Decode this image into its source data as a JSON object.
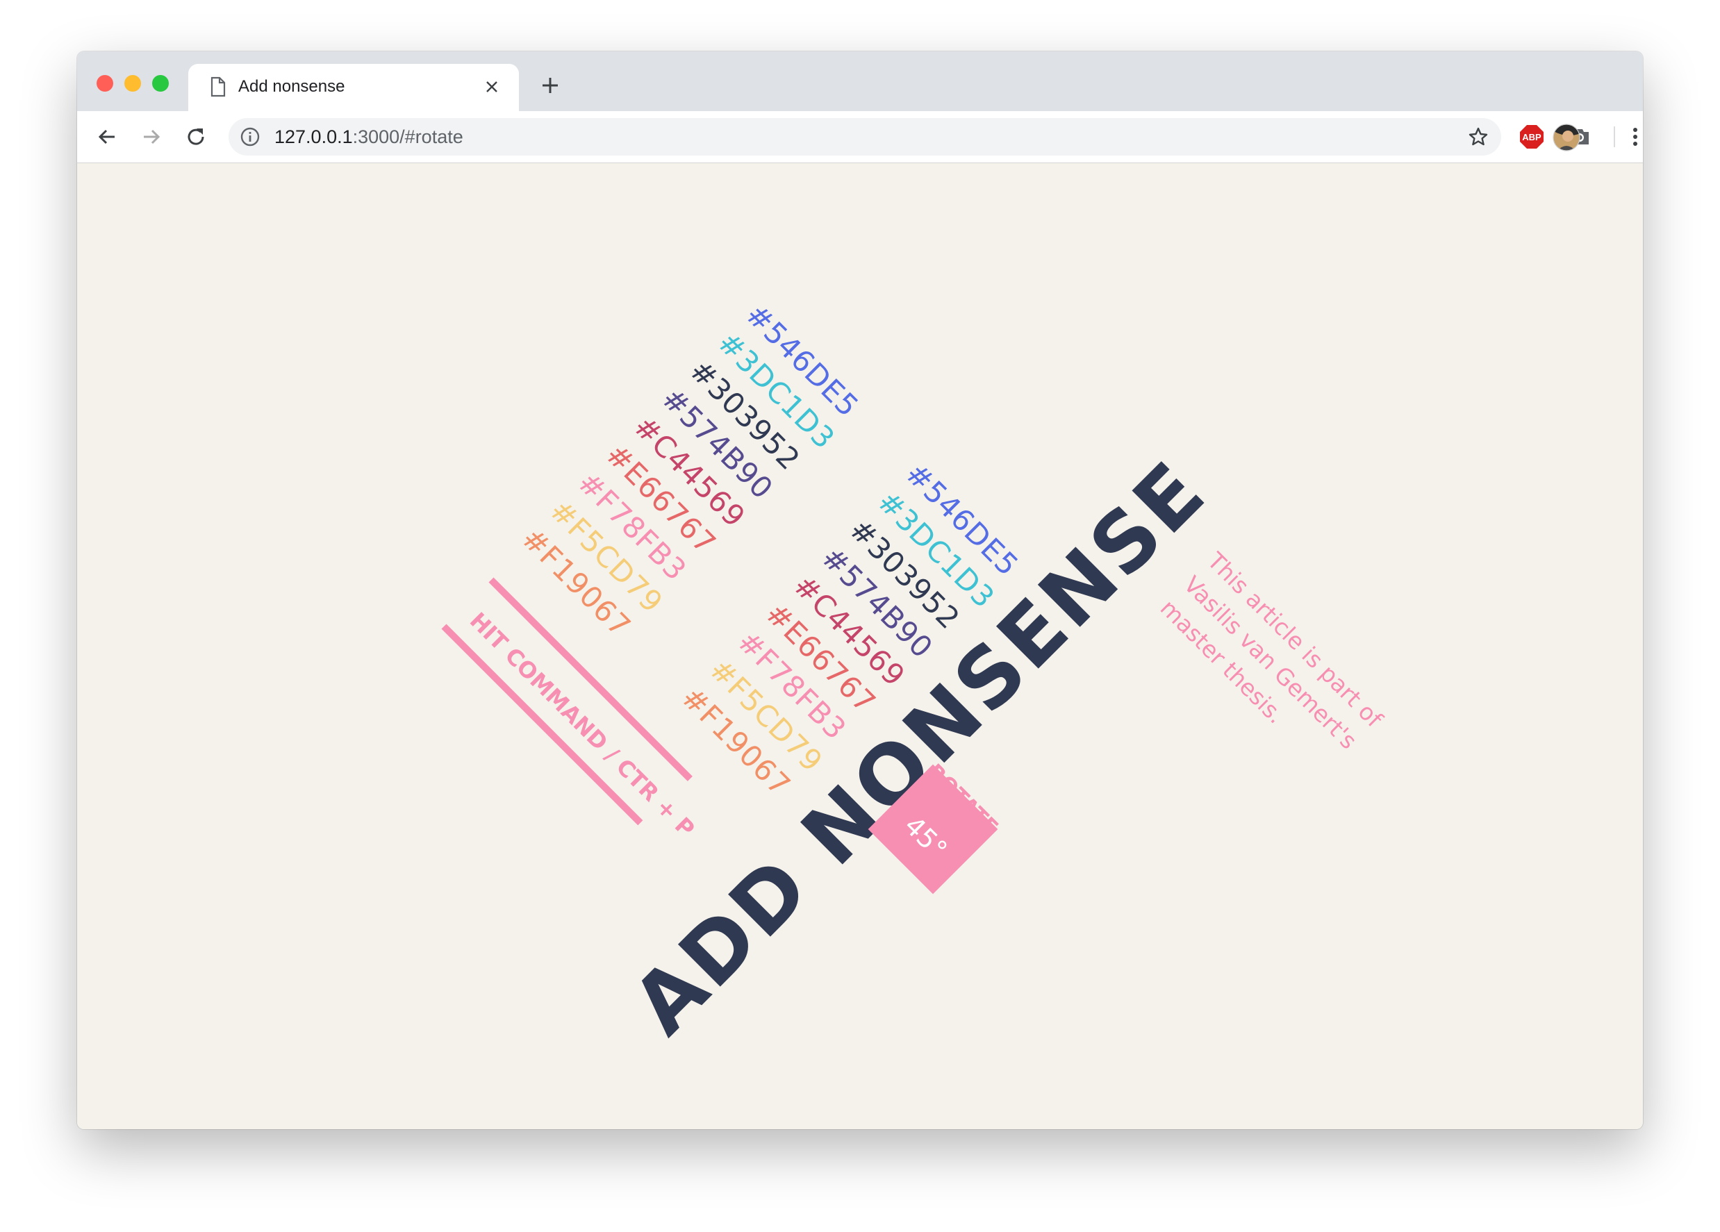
{
  "browser": {
    "tab_title": "Add nonsense",
    "url_host": "127.0.0.1",
    "url_rest": ":3000/#rotate",
    "extension_label": "ABP",
    "traffic_colors": [
      "#ff5f57",
      "#febc2e",
      "#28c840"
    ]
  },
  "page": {
    "title": "ADD NONSENSE",
    "print_hint": "HIT COMMAND / CTR + P",
    "article_lines": [
      "This article is part of",
      "Vasilis van Gemert's",
      "master thesis."
    ],
    "rotate_label": "ROTATE",
    "rotate_value": "45°",
    "palette": [
      {
        "label": "#546DE5",
        "color": "#546de5"
      },
      {
        "label": "#3DC1D3",
        "color": "#3dc1d3"
      },
      {
        "label": "#303952",
        "color": "#303952"
      },
      {
        "label": "#574B90",
        "color": "#574b90"
      },
      {
        "label": "#C44569",
        "color": "#c44569"
      },
      {
        "label": "#E66767",
        "color": "#e66767"
      },
      {
        "label": "#F78FB3",
        "color": "#f78fb3"
      },
      {
        "label": "#F5CD79",
        "color": "#f5cd79"
      },
      {
        "label": "#F19067",
        "color": "#f19067"
      }
    ],
    "palette_repeat": [
      {
        "label": "#546DE5",
        "color": "#546de5"
      },
      {
        "label": "#3DC1D3",
        "color": "#3dc1d3"
      },
      {
        "label": "#303952",
        "color": "#303952"
      },
      {
        "label": "#574B90",
        "color": "#574b90"
      },
      {
        "label": "#C44569",
        "color": "#c44569"
      },
      {
        "label": "#E66767",
        "color": "#e66767"
      },
      {
        "label": "#F78FB3",
        "color": "#f78fb3"
      },
      {
        "label": "#F5CD79",
        "color": "#f5cd79"
      },
      {
        "label": "#F19067",
        "color": "#f19067"
      }
    ],
    "background": "#f5f2eb",
    "accent": "#f78fb3",
    "title_color": "#303952"
  }
}
